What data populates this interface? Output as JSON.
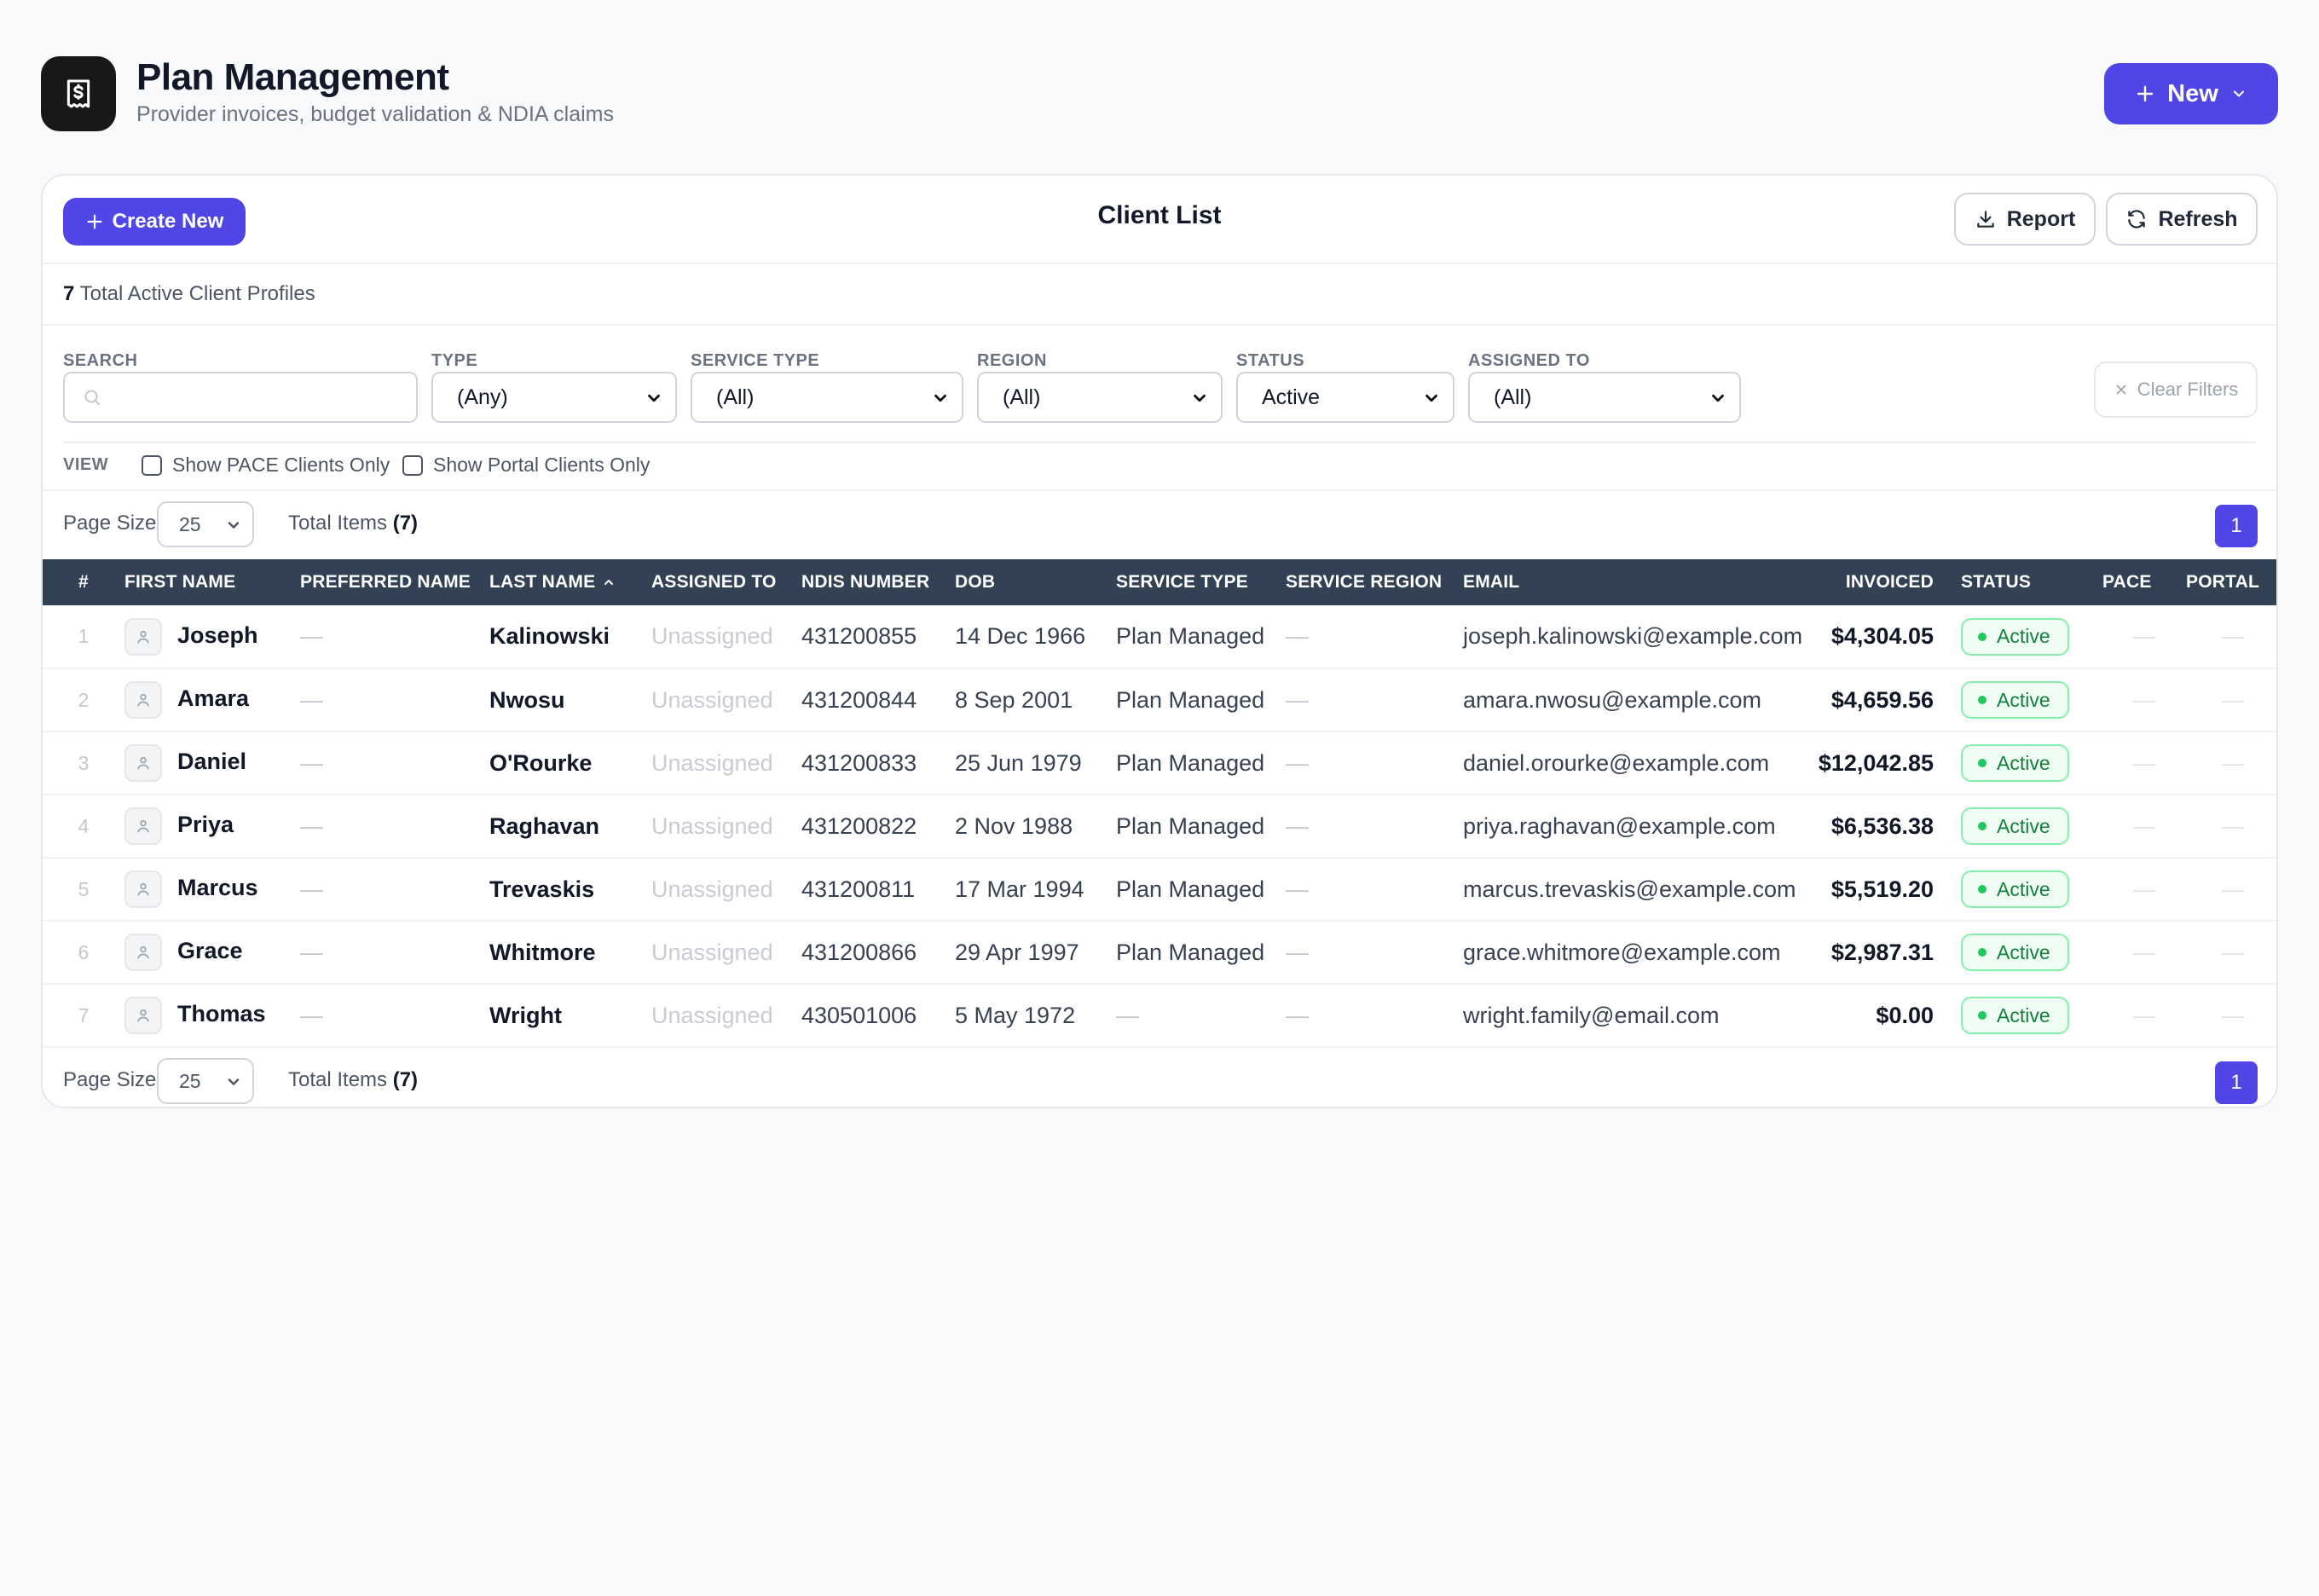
{
  "header": {
    "title": "Plan Management",
    "subtitle": "Provider invoices, budget validation & NDIA claims",
    "new_label": "New"
  },
  "card": {
    "create_label": "Create New",
    "title": "Client List",
    "report_label": "Report",
    "refresh_label": "Refresh"
  },
  "summary": {
    "count": "7",
    "text": "Total Active Client Profiles"
  },
  "filters": {
    "search_label": "SEARCH",
    "search_value": "",
    "type_label": "TYPE",
    "type_value": "(Any)",
    "service_type_label": "SERVICE TYPE",
    "service_type_value": "(All)",
    "region_label": "REGION",
    "region_value": "(All)",
    "status_label": "STATUS",
    "status_value": "Active",
    "assigned_label": "ASSIGNED TO",
    "assigned_value": "(All)",
    "clear_label": "Clear Filters",
    "view_label": "VIEW",
    "pace_only_label": "Show PACE Clients Only",
    "portal_only_label": "Show Portal Clients Only"
  },
  "pager": {
    "page_size_label": "Page Size",
    "page_size_value": "25",
    "total_items_label": "Total Items",
    "total_items_value": "(7)",
    "current_page": "1"
  },
  "table": {
    "columns": {
      "num": "#",
      "first": "FIRST NAME",
      "preferred": "PREFERRED NAME",
      "last": "LAST NAME",
      "assigned": "ASSIGNED TO",
      "ndis": "NDIS NUMBER",
      "dob": "DOB",
      "service_type": "SERVICE TYPE",
      "service_region": "SERVICE REGION",
      "email": "EMAIL",
      "invoiced": "INVOICED",
      "status": "STATUS",
      "pace": "PACE",
      "portal": "PORTAL"
    },
    "rows": [
      {
        "num": "1",
        "first": "Joseph",
        "preferred": "—",
        "last": "Kalinowski",
        "assigned": "Unassigned",
        "ndis": "431200855",
        "dob": "14 Dec 1966",
        "service_type": "Plan Managed",
        "service_region": "—",
        "email": "joseph.kalinowski@example.com",
        "invoiced": "$4,304.05",
        "status": "Active",
        "pace": "—",
        "portal": "—"
      },
      {
        "num": "2",
        "first": "Amara",
        "preferred": "—",
        "last": "Nwosu",
        "assigned": "Unassigned",
        "ndis": "431200844",
        "dob": "8 Sep 2001",
        "service_type": "Plan Managed",
        "service_region": "—",
        "email": "amara.nwosu@example.com",
        "invoiced": "$4,659.56",
        "status": "Active",
        "pace": "—",
        "portal": "—"
      },
      {
        "num": "3",
        "first": "Daniel",
        "preferred": "—",
        "last": "O'Rourke",
        "assigned": "Unassigned",
        "ndis": "431200833",
        "dob": "25 Jun 1979",
        "service_type": "Plan Managed",
        "service_region": "—",
        "email": "daniel.orourke@example.com",
        "invoiced": "$12,042.85",
        "status": "Active",
        "pace": "—",
        "portal": "—"
      },
      {
        "num": "4",
        "first": "Priya",
        "preferred": "—",
        "last": "Raghavan",
        "assigned": "Unassigned",
        "ndis": "431200822",
        "dob": "2 Nov 1988",
        "service_type": "Plan Managed",
        "service_region": "—",
        "email": "priya.raghavan@example.com",
        "invoiced": "$6,536.38",
        "status": "Active",
        "pace": "—",
        "portal": "—"
      },
      {
        "num": "5",
        "first": "Marcus",
        "preferred": "—",
        "last": "Trevaskis",
        "assigned": "Unassigned",
        "ndis": "431200811",
        "dob": "17 Mar 1994",
        "service_type": "Plan Managed",
        "service_region": "—",
        "email": "marcus.trevaskis@example.com",
        "invoiced": "$5,519.20",
        "status": "Active",
        "pace": "—",
        "portal": "—"
      },
      {
        "num": "6",
        "first": "Grace",
        "preferred": "—",
        "last": "Whitmore",
        "assigned": "Unassigned",
        "ndis": "431200866",
        "dob": "29 Apr 1997",
        "service_type": "Plan Managed",
        "service_region": "—",
        "email": "grace.whitmore@example.com",
        "invoiced": "$2,987.31",
        "status": "Active",
        "pace": "—",
        "portal": "—"
      },
      {
        "num": "7",
        "first": "Thomas",
        "preferred": "—",
        "last": "Wright",
        "assigned": "Unassigned",
        "ndis": "430501006",
        "dob": "5 May 1972",
        "service_type": "—",
        "service_region": "—",
        "email": "wright.family@email.com",
        "invoiced": "$0.00",
        "status": "Active",
        "pace": "—",
        "portal": "—"
      }
    ]
  },
  "colors": {
    "accent": "#4f46e5",
    "header_row": "#334155",
    "active_badge": "#15803d",
    "logo_bg": "#18181b"
  },
  "icons": [
    "dollar-receipt-icon",
    "plus-icon",
    "chevron-down-icon",
    "download-icon",
    "refresh-icon",
    "search-icon",
    "close-icon",
    "user-icon",
    "sort-up-icon"
  ]
}
